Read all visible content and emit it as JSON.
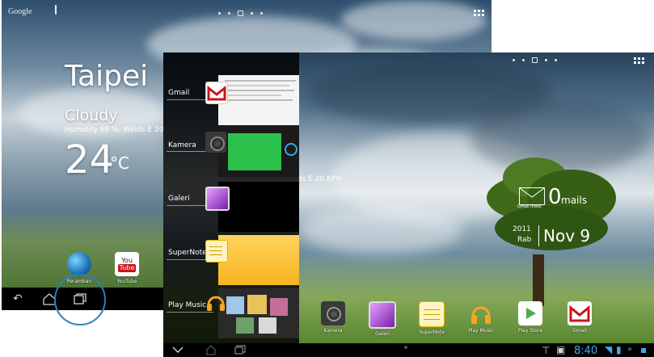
{
  "back_screen": {
    "search": {
      "google": "Google"
    },
    "city": "Taipei",
    "condition": "Cloudy",
    "details": "Humidity 68 %, Winds E 20 KPH",
    "temperature": "24",
    "unit": "°C",
    "apps": [
      {
        "label": "Peramban",
        "icon": "globe-icon"
      },
      {
        "label": "YouTube",
        "icon": "youtube-icon",
        "text_top": "You",
        "text_bottom": "Tube"
      }
    ]
  },
  "front_screen": {
    "recent_apps": [
      {
        "label": "Gmail",
        "icon": "gmail-icon"
      },
      {
        "label": "Kamera",
        "icon": "camera-icon"
      },
      {
        "label": "Galeri",
        "icon": "gallery-icon"
      },
      {
        "label": "SuperNote",
        "icon": "supernote-icon"
      },
      {
        "label": "Play Music",
        "icon": "headphones-icon"
      }
    ],
    "weather_overlap_text": "ds E 20 KPH",
    "mail": {
      "count": "0",
      "word": "mails",
      "sub": "Gmail Inbox"
    },
    "calendar": {
      "year": "2011",
      "weekday": "Rab",
      "date": "Nov 9"
    },
    "dock": [
      {
        "label": "Kamera",
        "icon": "camera-icon"
      },
      {
        "label": "Galeri",
        "icon": "gallery-icon"
      },
      {
        "label": "SuperNote",
        "icon": "supernote-icon"
      },
      {
        "label": "Play Music",
        "icon": "headphones-icon"
      },
      {
        "label": "Play Store",
        "icon": "play-store-icon"
      },
      {
        "label": "Gmail",
        "icon": "gmail-icon"
      }
    ],
    "status": {
      "time": "8:40"
    }
  },
  "colors": {
    "highlight_circle": "#2b7fc0",
    "clock": "#49a7e8"
  }
}
